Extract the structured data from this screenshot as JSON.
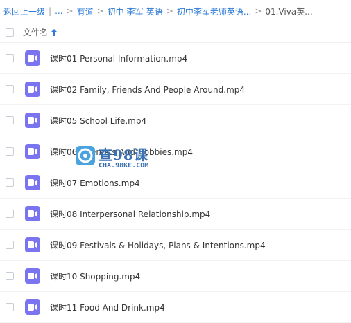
{
  "breadcrumb": {
    "back": "返回上一级",
    "sep": "|",
    "ellipsis": "...",
    "items": [
      "有道",
      "初中 李军-英语",
      "初中李军老师英语..."
    ],
    "current": "01.Viva英..."
  },
  "header": {
    "column_name": "文件名",
    "sort_direction": "ascending"
  },
  "files": [
    {
      "name": "课时01 Personal Information.mp4",
      "icon": "video-file-icon"
    },
    {
      "name": "课时02 Family, Friends And People Around.mp4",
      "icon": "video-file-icon"
    },
    {
      "name": "课时05 School Life.mp4",
      "icon": "video-file-icon"
    },
    {
      "name": "课时06 Interests And Hobbies.mp4",
      "icon": "video-file-icon"
    },
    {
      "name": "课时07 Emotions.mp4",
      "icon": "video-file-icon"
    },
    {
      "name": "课时08 Interpersonal Relationship.mp4",
      "icon": "video-file-icon"
    },
    {
      "name": "课时09 Festivals & Holidays, Plans & Intentions.mp4",
      "icon": "video-file-icon"
    },
    {
      "name": "课时10 Shopping.mp4",
      "icon": "video-file-icon"
    },
    {
      "name": "课时11 Food And Drink.mp4",
      "icon": "video-file-icon"
    }
  ],
  "watermark": {
    "text": "查98课",
    "sub": "CHA.98KE.COM"
  },
  "colors": {
    "link": "#2e7bd6",
    "video_icon": "#7b74f0",
    "watermark": "#3a6fb0"
  }
}
